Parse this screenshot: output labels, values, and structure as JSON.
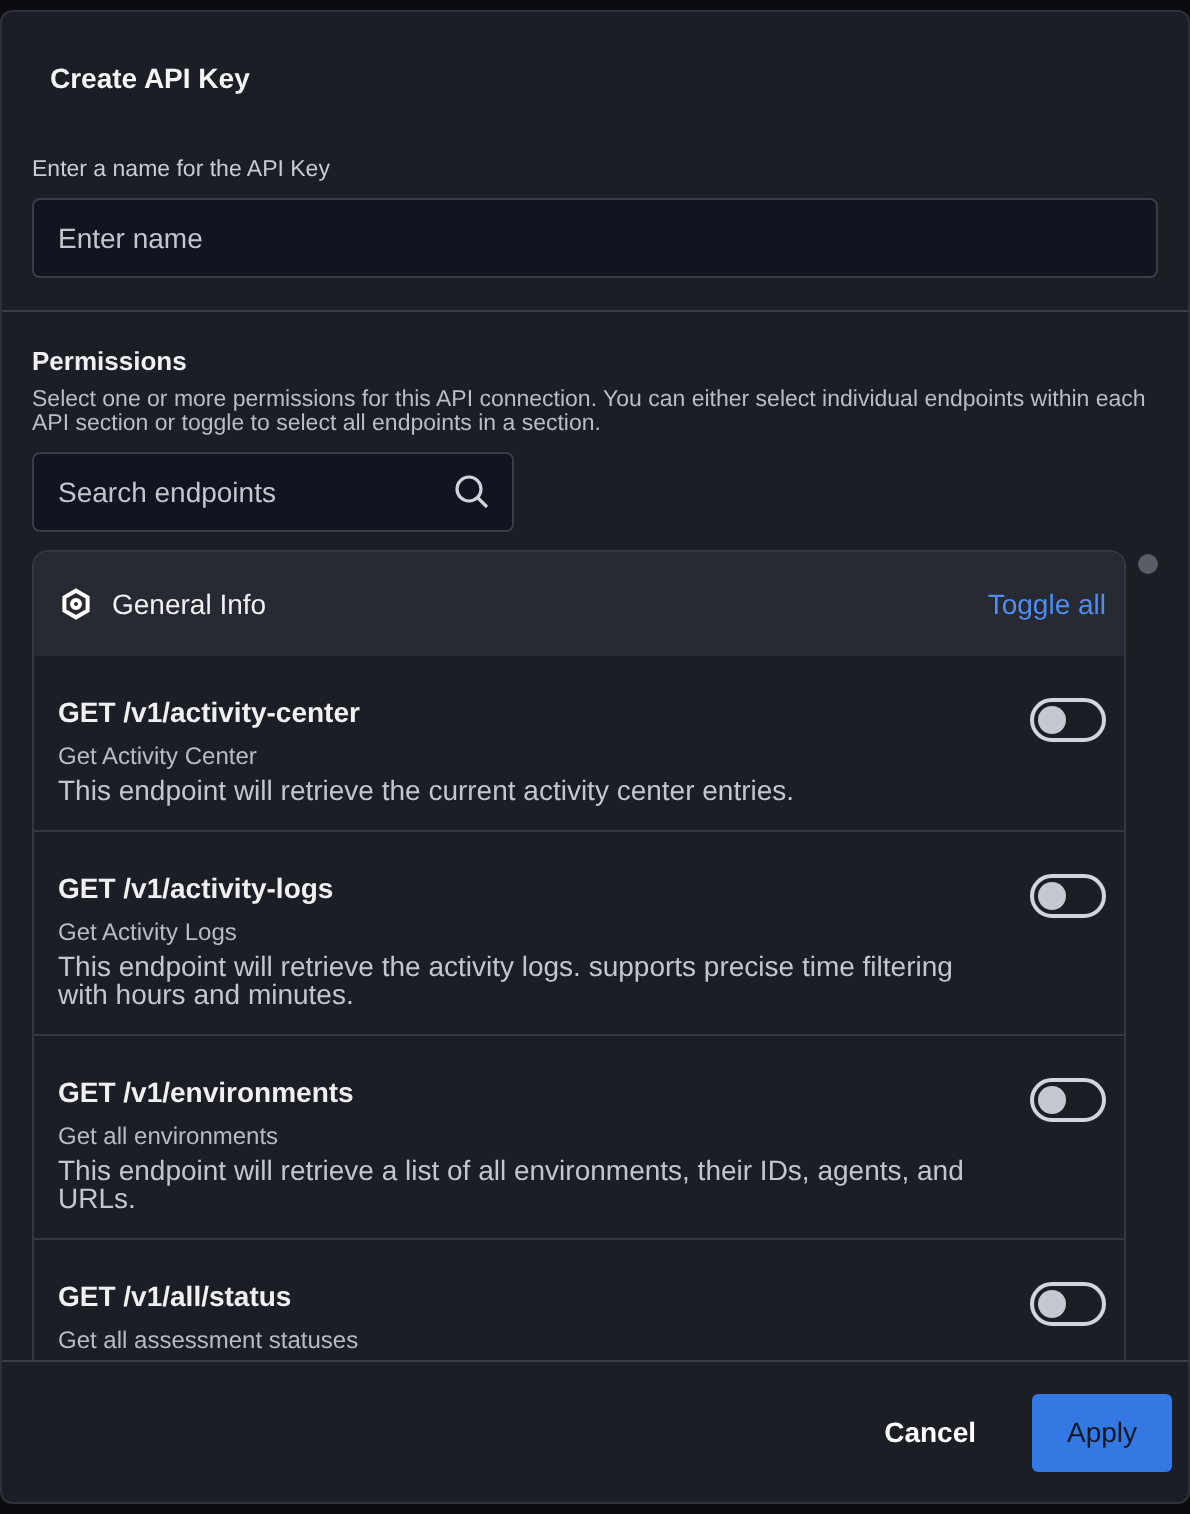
{
  "dialog": {
    "title": "Create API Key"
  },
  "name_field": {
    "label": "Enter a name for the API Key",
    "placeholder": "Enter name"
  },
  "permissions": {
    "title": "Permissions",
    "description": "Select one or more permissions for this API connection. You can either select individual endpoints within each API section or toggle to select all endpoints in a section.",
    "search": {
      "placeholder": "Search endpoints"
    },
    "section": {
      "title": "General Info",
      "toggle_all": "Toggle all",
      "endpoints": [
        {
          "path": "GET /v1/activity-center",
          "name": "Get Activity Center",
          "description": "This endpoint will retrieve the current activity center entries.",
          "on": false
        },
        {
          "path": "GET /v1/activity-logs",
          "name": "Get Activity Logs",
          "description": "This endpoint will retrieve the activity logs. supports precise time filtering with hours and minutes.",
          "on": false
        },
        {
          "path": "GET /v1/environments",
          "name": "Get all environments",
          "description": "This endpoint will retrieve a list of all environments, their IDs, agents, and URLs.",
          "on": false
        },
        {
          "path": "GET /v1/all/status",
          "name": "Get all assessment statuses",
          "on": false
        }
      ]
    }
  },
  "buttons": {
    "cancel": "Cancel",
    "apply": "Apply"
  }
}
